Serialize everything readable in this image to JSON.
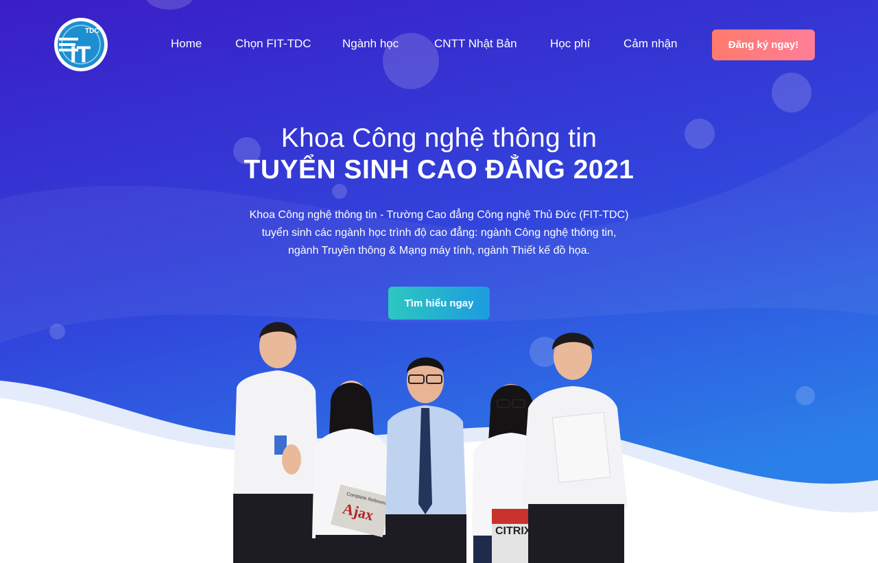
{
  "logo": {
    "text": "IT",
    "badge": "TDC"
  },
  "nav": {
    "items": [
      {
        "label": "Home"
      },
      {
        "label": "Chọn FIT-TDC"
      },
      {
        "label": "Ngành học"
      },
      {
        "label": "CNTT Nhật Bản"
      },
      {
        "label": "Học phí"
      },
      {
        "label": "Cảm nhận"
      }
    ],
    "register_label": "Đăng ký ngay!"
  },
  "hero": {
    "title_line1": "Khoa Công nghệ thông tin",
    "title_line2": "TUYỂN SINH CAO ĐẲNG 2021",
    "description": [
      "Khoa Công nghệ thông tin - Trường Cao đẳng Công nghệ Thủ Đức (FIT-TDC)",
      "tuyển sinh các ngành học trình độ cao đẳng: ngành Công nghệ thông tin,",
      "ngành Truyền thông & Mạng máy tính, ngành Thiết kế đồ họa."
    ],
    "cta_label": "Tìm hiểu ngay",
    "book_ajax_title": "Ajax",
    "book_ajax_subtitle": "Complete Reference",
    "book_citrix_title": "CITRIX"
  },
  "colors": {
    "bg_top": "#3a1fc9",
    "bg_bottom": "#2f7ee6",
    "register_button": "#ff7a7f",
    "cta_button": "#23b6cf"
  }
}
